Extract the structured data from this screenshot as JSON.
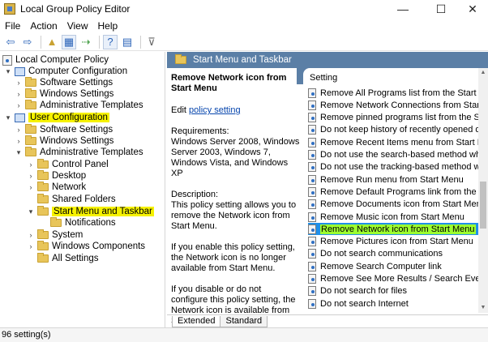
{
  "window": {
    "title": "Local Group Policy Editor",
    "minimize": "—",
    "maximize": "☐",
    "close": "✕"
  },
  "menu": [
    "File",
    "Action",
    "View",
    "Help"
  ],
  "toolbar": {
    "back": "⇦",
    "forward": "⇨",
    "up": "▲",
    "show": "▦",
    "export": "⇢",
    "help": "?",
    "props": "▤",
    "filter": "⊽"
  },
  "tree": [
    {
      "label": "Local Computer Policy"
    },
    {
      "label": "Computer Configuration"
    },
    {
      "label": "Software Settings"
    },
    {
      "label": "Windows Settings"
    },
    {
      "label": "Administrative Templates"
    },
    {
      "label": "User Configuration"
    },
    {
      "label": "Software Settings"
    },
    {
      "label": "Windows Settings"
    },
    {
      "label": "Administrative Templates"
    },
    {
      "label": "Control Panel"
    },
    {
      "label": "Desktop"
    },
    {
      "label": "Network"
    },
    {
      "label": "Shared Folders"
    },
    {
      "label": "Start Menu and Taskbar"
    },
    {
      "label": "Notifications"
    },
    {
      "label": "System"
    },
    {
      "label": "Windows Components"
    },
    {
      "label": "All Settings"
    }
  ],
  "right_header": "Start Menu and Taskbar",
  "description": {
    "title": "Remove Network icon from Start Menu",
    "edit_prefix": "Edit ",
    "edit_link": "policy setting",
    "requirements": "Requirements:\nWindows Server 2008, Windows Server 2003, Windows 7, Windows Vista, and Windows XP",
    "description": "Description:\nThis policy setting allows you to remove the Network icon from Start Menu.",
    "enable": "If you enable this policy setting, the Network icon is no longer available from Start Menu.",
    "disable": "If you disable or do not configure this policy setting, the Network icon is available from Start Menu."
  },
  "list_header": "Setting",
  "settings": [
    "Remove All Programs list from the Start menu",
    "Remove Network Connections from Start Menu",
    "Remove pinned programs list from the Start Menu",
    "Do not keep history of recently opened documents",
    "Remove Recent Items menu from Start Menu",
    "Do not use the search-based method when resolving shell shortcuts",
    "Do not use the tracking-based method when resolving shell shortcuts",
    "Remove Run menu from Start Menu",
    "Remove Default Programs link from the Start menu",
    "Remove Documents icon from Start Menu",
    "Remove Music icon from Start Menu",
    "Remove Network icon from Start Menu",
    "Remove Pictures icon from Start Menu",
    "Do not search communications",
    "Remove Search Computer link",
    "Remove See More Results / Search Everywhere link",
    "Do not search for files",
    "Do not search Internet"
  ],
  "selected_setting_index": 11,
  "tabs": [
    "Extended",
    "Standard"
  ],
  "status": "96 setting(s)",
  "colors": {
    "header_bg": "#5b7fa6",
    "selection": "#1f8fe8",
    "highlight_yellow": "#f6f200",
    "highlight_green": "#9cff30"
  }
}
